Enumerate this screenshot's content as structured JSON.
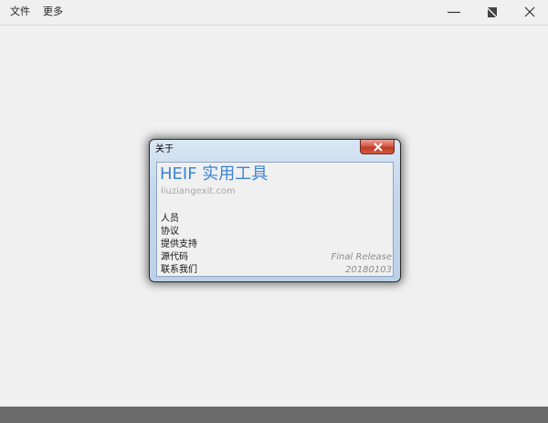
{
  "menu": {
    "file": "文件",
    "more": "更多"
  },
  "window_controls": {
    "minimize_icon": "minimize-icon",
    "restore_icon": "restore-icon",
    "close_icon": "close-icon"
  },
  "dialog": {
    "title": "关于",
    "app_name": "HEIF 实用工具",
    "website": "liuziangexit.com",
    "links": {
      "people": "人员",
      "license": "协议",
      "support": "提供支持",
      "source": "源代码",
      "contact": "联系我们"
    },
    "release_channel": "Final Release",
    "release_date": "20180103"
  },
  "colors": {
    "app_name": "#3a84d6",
    "background": "#f0f0f0",
    "bottom_bar": "#6b6b6b",
    "close_button": "#c13a28"
  }
}
